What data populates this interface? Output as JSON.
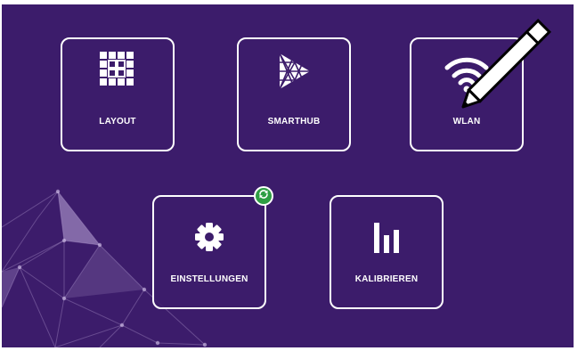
{
  "tiles": {
    "layout": "LAYOUT",
    "smarthub": "SMARTHUB",
    "wlan": "WLAN",
    "einstellungen": "EINSTELLUNGEN",
    "kalibrieren": "KALIBRIEREN"
  },
  "icons": {
    "layout": "grid-icon",
    "smarthub": "play-triangle-icon",
    "wlan": "wifi-icon",
    "einstellungen": "gear-icon",
    "kalibrieren": "bar-chart-icon",
    "update_badge": "sync-icon",
    "pointer": "pen-icon"
  },
  "colors": {
    "background": "#3c1c6b",
    "tile_border": "#ffffff",
    "badge": "#2e9e43"
  }
}
